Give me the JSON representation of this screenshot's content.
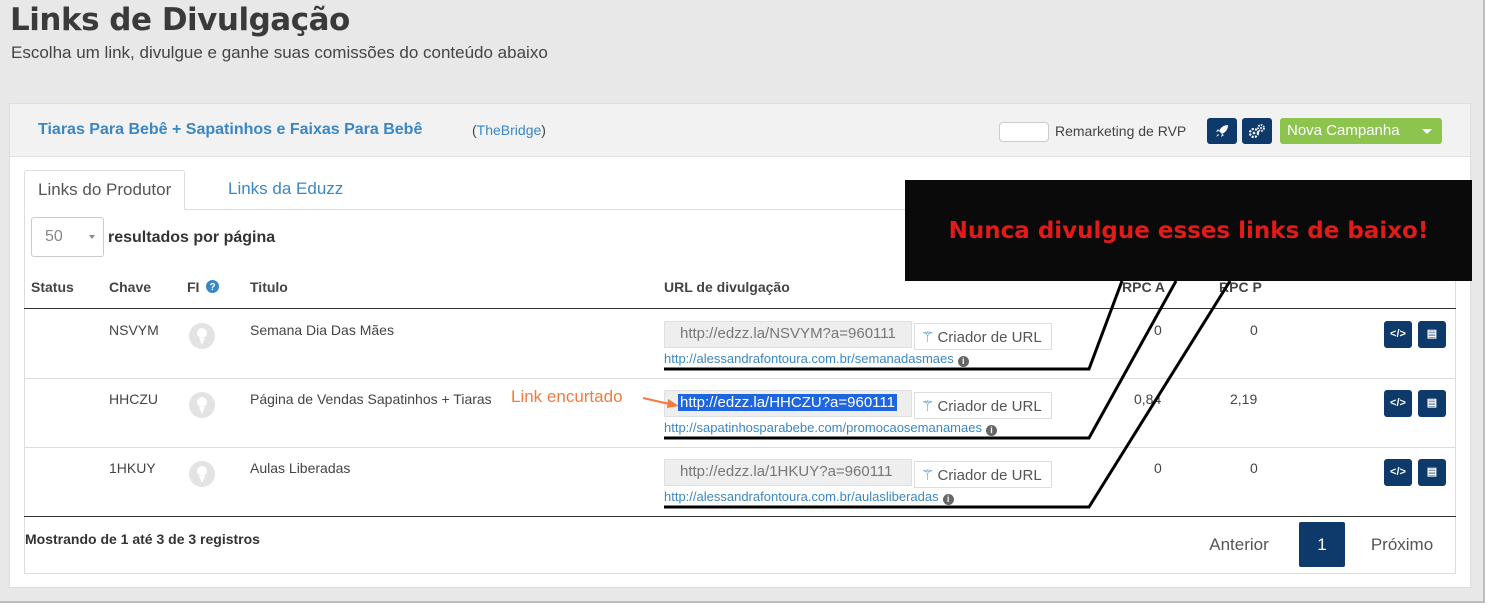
{
  "header": {
    "title": "Links de Divulgação",
    "subtitle": "Escolha um link, divulgue e ganhe suas comissões do conteúdo abaixo"
  },
  "product": {
    "name": "Tiaras Para Bebê + Sapatinhos e Faixas Para Bebê",
    "source_open": "(",
    "source_name": "TheBridge",
    "source_close": ")",
    "remarketing_label": "Remarketing de RVP",
    "new_campaign_label": "Nova Campanha"
  },
  "tabs": [
    {
      "label": "Links do Produtor",
      "active": true
    },
    {
      "label": "Links da Eduzz",
      "active": false
    }
  ],
  "pager_select": {
    "value": "50",
    "label": "resultados por página"
  },
  "columns": {
    "status": "Status",
    "chave": "Chave",
    "fi": "FI",
    "titulo": "Titulo",
    "url": "URL de divulgação",
    "rpc_a": "RPC A",
    "rpc_p": "RPC P"
  },
  "rows": [
    {
      "chave": "NSVYM",
      "titulo": "Semana Dia Das Mães",
      "short_url": "http://edzz.la/NSVYM?a=960111",
      "creator": "Criador de URL",
      "target": "http://alessandrafontoura.com.br/semanadasmaes",
      "rpc_a": "0",
      "rpc_p": "0",
      "selected": false
    },
    {
      "chave": "HHCZU",
      "titulo": "Página de Vendas Sapatinhos + Tiaras",
      "short_url": "http://edzz.la/HHCZU?a=960111",
      "creator": "Criador de URL",
      "target": "http://sapatinhosparabebe.com/promocaosemanamaes",
      "rpc_a": "0,84",
      "rpc_p": "2,19",
      "selected": true
    },
    {
      "chave": "1HKUY",
      "titulo": "Aulas Liberadas",
      "short_url": "http://edzz.la/1HKUY?a=960111",
      "creator": "Criador de URL",
      "target": "http://alessandrafontoura.com.br/aulasliberadas",
      "rpc_a": "0",
      "rpc_p": "0",
      "selected": false
    }
  ],
  "footer": {
    "summary": "Mostrando de 1 até 3 de 3 registros",
    "prev": "Anterior",
    "current": "1",
    "next": "Próximo"
  },
  "annotations": {
    "banner": "Nunca divulgue esses links de baixo!",
    "short_link": "Link encurtado"
  },
  "colors": {
    "brand_navy": "#0d3a6b",
    "link_blue": "#3a87c4",
    "campaign_green": "#8cc44d",
    "warning_red": "#e11a1a",
    "annotation_orange": "#f47a3a"
  },
  "icons": {
    "rocket": "rocket-icon",
    "settings": "gears-icon",
    "help": "question-circle-icon",
    "wand": "magic-wand-icon",
    "code": "code-icon",
    "embed": "file-code-icon",
    "info": "info-icon"
  }
}
